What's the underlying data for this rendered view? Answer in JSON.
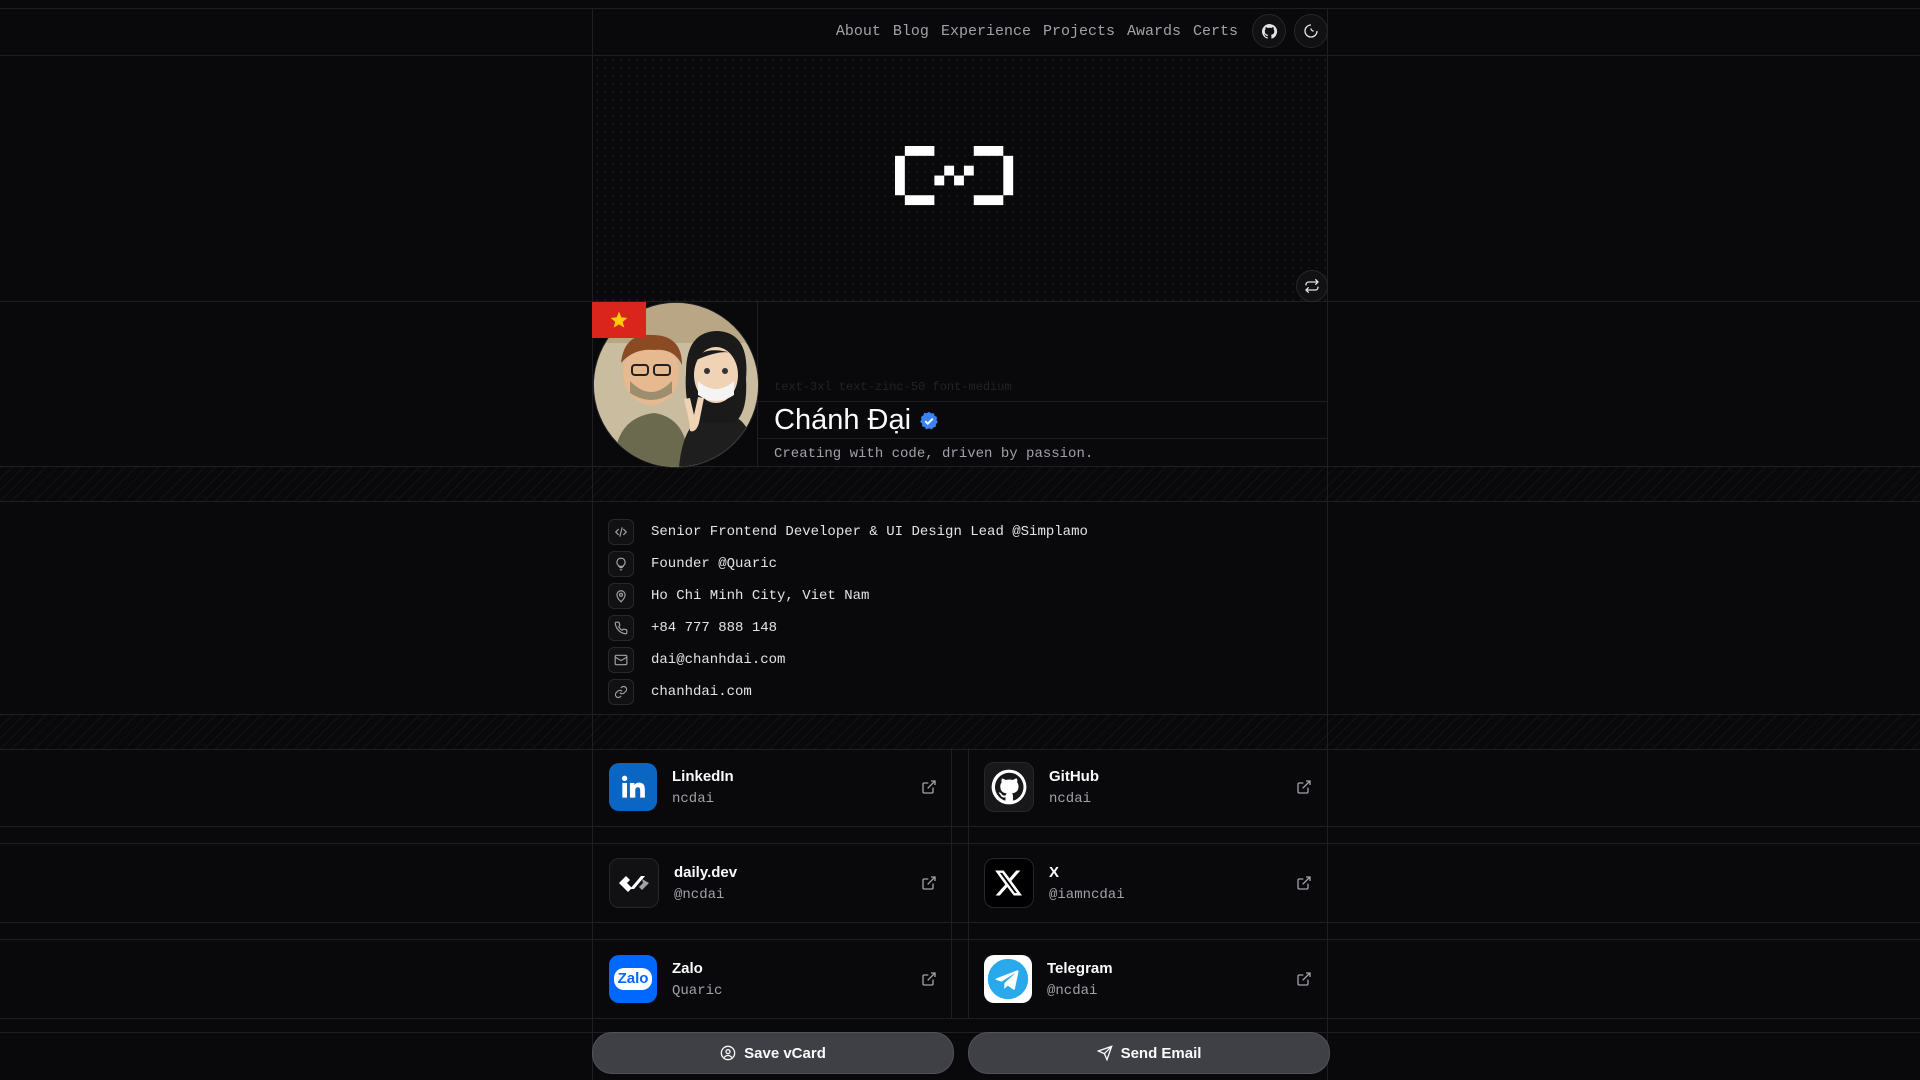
{
  "nav": {
    "links": [
      "About",
      "Blog",
      "Experience",
      "Projects",
      "Awards",
      "Certs"
    ],
    "github_icon": "github-icon",
    "theme_icon": "theme-toggle-icon"
  },
  "profile": {
    "ghost_classes": "text-3xl text-zinc-50 font-medium",
    "name": "Chánh Đại",
    "tagline": "Creating with code, driven by passion.",
    "verified_color": "#3b82f6",
    "flag_color": "#da251d"
  },
  "info": [
    {
      "icon": "code-icon",
      "text": "Senior Frontend Developer & UI Design Lead @Simplamo"
    },
    {
      "icon": "lightbulb-icon",
      "text": "Founder @Quaric"
    },
    {
      "icon": "map-pin-icon",
      "text": "Ho Chi Minh City, Viet Nam"
    },
    {
      "icon": "phone-icon",
      "text": "+84 777 888 148"
    },
    {
      "icon": "mail-icon",
      "text": "dai@chanhdai.com"
    },
    {
      "icon": "link-icon",
      "text": "chanhdai.com"
    }
  ],
  "socials": [
    {
      "title": "LinkedIn",
      "handle": "ncdai",
      "icon": "linkedin-icon"
    },
    {
      "title": "GitHub",
      "handle": "ncdai",
      "icon": "github-icon"
    },
    {
      "title": "daily.dev",
      "handle": "@ncdai",
      "icon": "dailydev-icon"
    },
    {
      "title": "X",
      "handle": "@iamncdai",
      "icon": "x-icon"
    },
    {
      "title": "Zalo",
      "handle": "Quaric",
      "icon": "zalo-icon",
      "logo_text": "Zalo"
    },
    {
      "title": "Telegram",
      "handle": "@ncdai",
      "icon": "telegram-icon"
    }
  ],
  "actions": {
    "save_vcard": "Save vCard",
    "send_email": "Send Email"
  }
}
